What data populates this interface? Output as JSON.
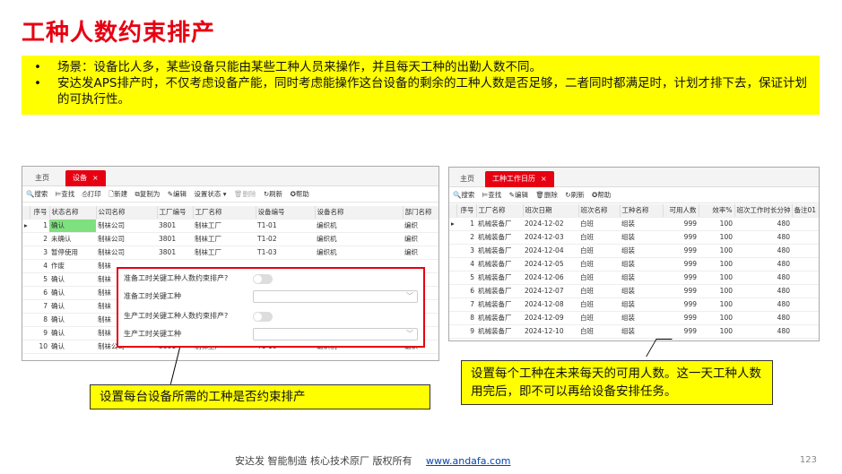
{
  "title": "工种人数约束排产",
  "bullets": [
    "场景：设备比人多，某些设备只能由某些工种人员来操作，并且每天工种的出勤人数不同。",
    "安达发APS排产时，不仅考虑设备产能，同时考虑能操作这台设备的剩余的工种人数是否足够，二者同时都满足时，计划才排下去，保证计划的可执行性。"
  ],
  "left_panel": {
    "tabs": [
      "主页",
      "设备"
    ],
    "close": "×",
    "toolbar": [
      "🔍搜索",
      "⊨查找",
      "⎙打印",
      "🗋新建",
      "⧉复制为",
      "✎编辑",
      "设置状态 ▾",
      "🗑删除",
      "↻刷新",
      "✪帮助"
    ],
    "columns": [
      "序号",
      "状态名称",
      "公司名称",
      "工厂编号",
      "工厂名称",
      "设备编号",
      "设备名称",
      "部门名称"
    ],
    "rows": [
      [
        "▸",
        "1",
        "确认",
        "制袜公司",
        "3801",
        "制袜工厂",
        "T1-01",
        "编织机",
        "编织"
      ],
      [
        "",
        "2",
        "未确认",
        "制袜公司",
        "3801",
        "制袜工厂",
        "T1-02",
        "编织机",
        "编织"
      ],
      [
        "",
        "3",
        "暂停使用",
        "制袜公司",
        "3801",
        "制袜工厂",
        "T1-03",
        "编织机",
        "编织"
      ],
      [
        "",
        "4",
        "作废",
        "制袜",
        "",
        "",
        "",
        "",
        ""
      ],
      [
        "",
        "5",
        "确认",
        "制袜",
        "",
        "",
        "",
        "",
        ""
      ],
      [
        "",
        "6",
        "确认",
        "制袜",
        "",
        "",
        "",
        "",
        ""
      ],
      [
        "",
        "7",
        "确认",
        "制袜",
        "",
        "",
        "",
        "",
        ""
      ],
      [
        "",
        "8",
        "确认",
        "制袜",
        "",
        "",
        "",
        "",
        ""
      ],
      [
        "",
        "9",
        "确认",
        "制袜",
        "",
        "",
        "",
        "",
        ""
      ],
      [
        "",
        "10",
        "确认",
        "制袜公司",
        "3801",
        "制袜工厂",
        "T1-10",
        "编织机",
        "编织"
      ]
    ]
  },
  "dialog": {
    "rows": [
      "准备工时关键工种人数约束排产?",
      "准备工时关键工种",
      "生产工时关键工种人数约束排产?",
      "生产工时关键工种"
    ],
    "chevron": "﹀"
  },
  "right_panel": {
    "tabs": [
      "主页",
      "工种工作日历"
    ],
    "close": "×",
    "toolbar": [
      "🔍搜索",
      "⊨查找",
      "✎编辑",
      "🗑删除",
      "↻刷新",
      "✪帮助"
    ],
    "columns": [
      "序号",
      "工厂名称",
      "班次日期",
      "班次名称",
      "工种名称",
      "可用人数",
      "效率%",
      "班次工作时长分钟",
      "备注01"
    ],
    "rows": [
      [
        "▸",
        "1",
        "机械装备厂",
        "2024-12-02",
        "白班",
        "组装",
        "999",
        "100",
        "480",
        ""
      ],
      [
        "",
        "2",
        "机械装备厂",
        "2024-12-03",
        "白班",
        "组装",
        "999",
        "100",
        "480",
        ""
      ],
      [
        "",
        "3",
        "机械装备厂",
        "2024-12-04",
        "白班",
        "组装",
        "999",
        "100",
        "480",
        ""
      ],
      [
        "",
        "4",
        "机械装备厂",
        "2024-12-05",
        "白班",
        "组装",
        "999",
        "100",
        "480",
        ""
      ],
      [
        "",
        "5",
        "机械装备厂",
        "2024-12-06",
        "白班",
        "组装",
        "999",
        "100",
        "480",
        ""
      ],
      [
        "",
        "6",
        "机械装备厂",
        "2024-12-07",
        "白班",
        "组装",
        "999",
        "100",
        "480",
        ""
      ],
      [
        "",
        "7",
        "机械装备厂",
        "2024-12-08",
        "白班",
        "组装",
        "999",
        "100",
        "480",
        ""
      ],
      [
        "",
        "8",
        "机械装备厂",
        "2024-12-09",
        "白班",
        "组装",
        "999",
        "100",
        "480",
        ""
      ],
      [
        "",
        "9",
        "机械装备厂",
        "2024-12-10",
        "白班",
        "组装",
        "999",
        "100",
        "480",
        ""
      ],
      [
        "",
        "10",
        "机械装备厂",
        "2024-12-11",
        "白班",
        "组装",
        "999",
        "100",
        "480",
        ""
      ]
    ]
  },
  "note1": "设置每台设备所需的工种是否约束排产",
  "note2": "设置每个工种在未来每天的可用人数。这一天工种人数用完后，即不可以再给设备安排任务。",
  "footer": {
    "text": "安达发   智能制造 核心技术原厂   版权所有",
    "url": "www.andafa.com",
    "page": "123"
  },
  "colors": {
    "title": "#e60012",
    "highlight": "#ffff00",
    "tab_active": "#e60012",
    "status_green": "#7fe07f"
  }
}
